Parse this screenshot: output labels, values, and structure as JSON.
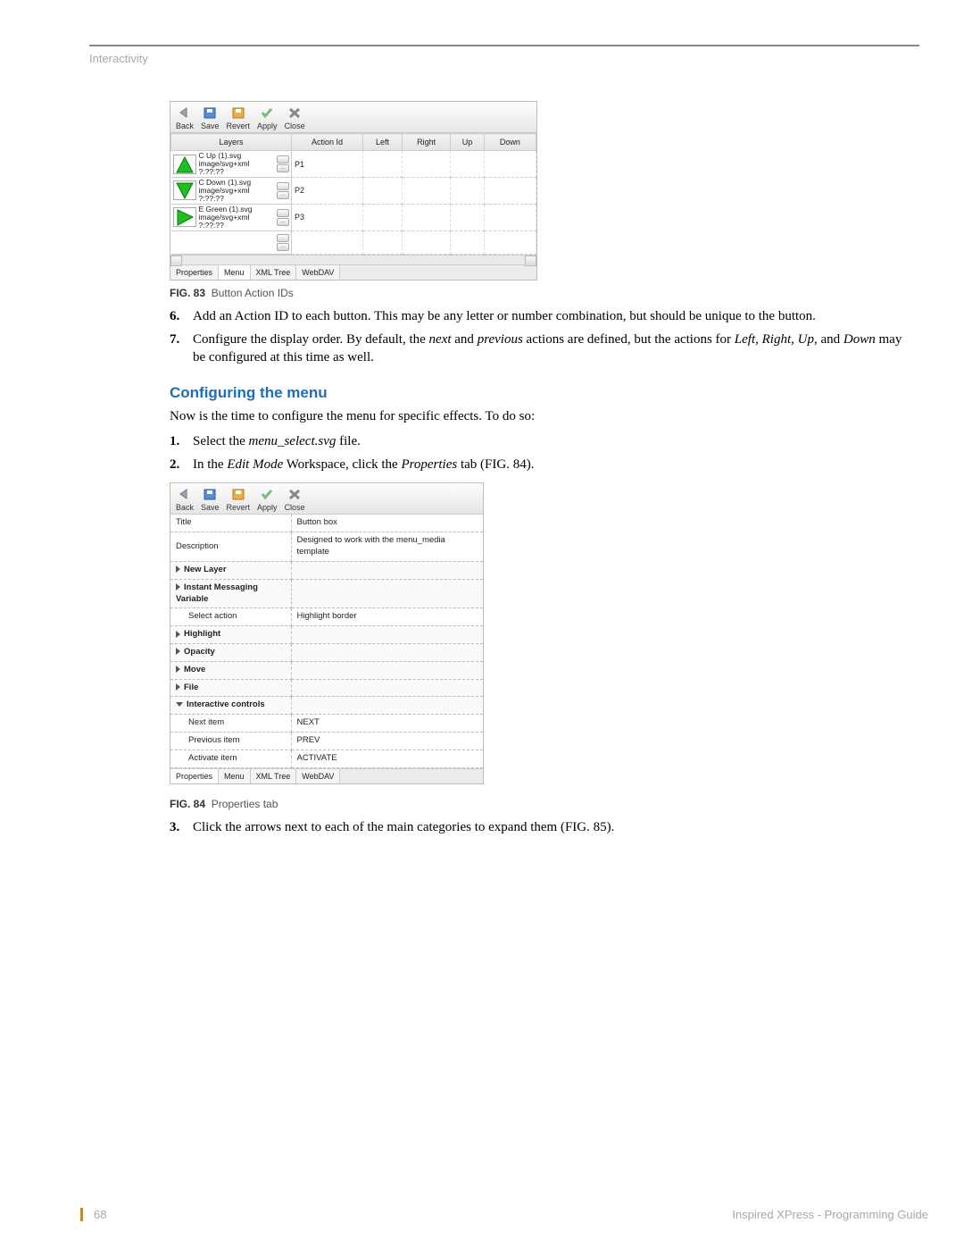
{
  "header": {
    "section": "Interactivity"
  },
  "fig83": {
    "caption_label": "FIG. 83",
    "caption_text": "Button Action IDs",
    "toolbar": {
      "back": "Back",
      "save": "Save",
      "revert": "Revert",
      "apply": "Apply",
      "close": "Close"
    },
    "columns": {
      "layers": "Layers",
      "action": "Action Id",
      "left": "Left",
      "right": "Right",
      "up": "Up",
      "down": "Down"
    },
    "rows": [
      {
        "arrow": "up",
        "color": "#1fbf1f",
        "name": "C Up (1).svg",
        "mime": "image/svg+xml",
        "dim": "?:??:??",
        "action": "P1"
      },
      {
        "arrow": "down",
        "color": "#1fbf1f",
        "name": "C Down (1).svg",
        "mime": "image/svg+xml",
        "dim": "?:??:??",
        "action": "P2"
      },
      {
        "arrow": "right",
        "color": "#1fbf1f",
        "name": "E Green (1).svg",
        "mime": "image/svg+xml",
        "dim": "?:??:??",
        "action": "P3"
      }
    ],
    "tabs": [
      "Properties",
      "Menu",
      "XML Tree",
      "WebDAV"
    ]
  },
  "steps_a": [
    {
      "n": "6.",
      "html": "Add an Action ID to each button. This may be any letter or number combination, but should be unique to the button."
    },
    {
      "n": "7.",
      "html": "Configure the display order. By default, the <em>next</em> and <em>previous</em> actions are defined, but the actions for <em>Left</em>, <em>Right</em>, <em>Up</em>, and <em>Down</em> may be configured at this time as well."
    }
  ],
  "section_b": {
    "heading": "Configuring the menu",
    "intro": "Now is the time to configure the menu for specific effects. To do so:",
    "steps": [
      {
        "n": "1.",
        "html": "Select the <em>menu_select.svg</em> file."
      },
      {
        "n": "2.",
        "html": "In the <em>Edit Mode</em> Workspace, click the <em>Properties</em> tab (FIG. 84)."
      }
    ]
  },
  "fig84": {
    "caption_label": "FIG. 84",
    "caption_text": "Properties tab",
    "toolbar": {
      "back": "Back",
      "save": "Save",
      "revert": "Revert",
      "apply": "Apply",
      "close": "Close"
    },
    "rows": [
      {
        "type": "plain",
        "k": "Title",
        "v": "Button box"
      },
      {
        "type": "plain",
        "k": "Description",
        "v": "Designed to work with the menu_media template"
      },
      {
        "type": "cat",
        "k": "New Layer",
        "v": ""
      },
      {
        "type": "cat",
        "k": "Instant Messaging Variable",
        "v": ""
      },
      {
        "type": "plain",
        "k": "Select action",
        "v": "Highlight border",
        "indent": true
      },
      {
        "type": "cat",
        "k": "Highlight",
        "v": ""
      },
      {
        "type": "cat",
        "k": "Opacity",
        "v": ""
      },
      {
        "type": "cat",
        "k": "Move",
        "v": ""
      },
      {
        "type": "cat",
        "k": "File",
        "v": ""
      },
      {
        "type": "cat-open",
        "k": "Interactive controls",
        "v": ""
      },
      {
        "type": "plain",
        "k": "Next item",
        "v": "NEXT",
        "indent": true
      },
      {
        "type": "plain",
        "k": "Previous item",
        "v": "PREV",
        "indent": true
      },
      {
        "type": "plain",
        "k": "Activate item",
        "v": "ACTIVATE",
        "indent": true
      }
    ],
    "tabs": [
      "Properties",
      "Menu",
      "XML Tree",
      "WebDAV"
    ]
  },
  "steps_c": [
    {
      "n": "3.",
      "html": "Click the arrows next to each of the main categories to expand them (FIG. 85)."
    }
  ],
  "footer": {
    "page": "68",
    "title": "Inspired XPress - Programming Guide"
  }
}
